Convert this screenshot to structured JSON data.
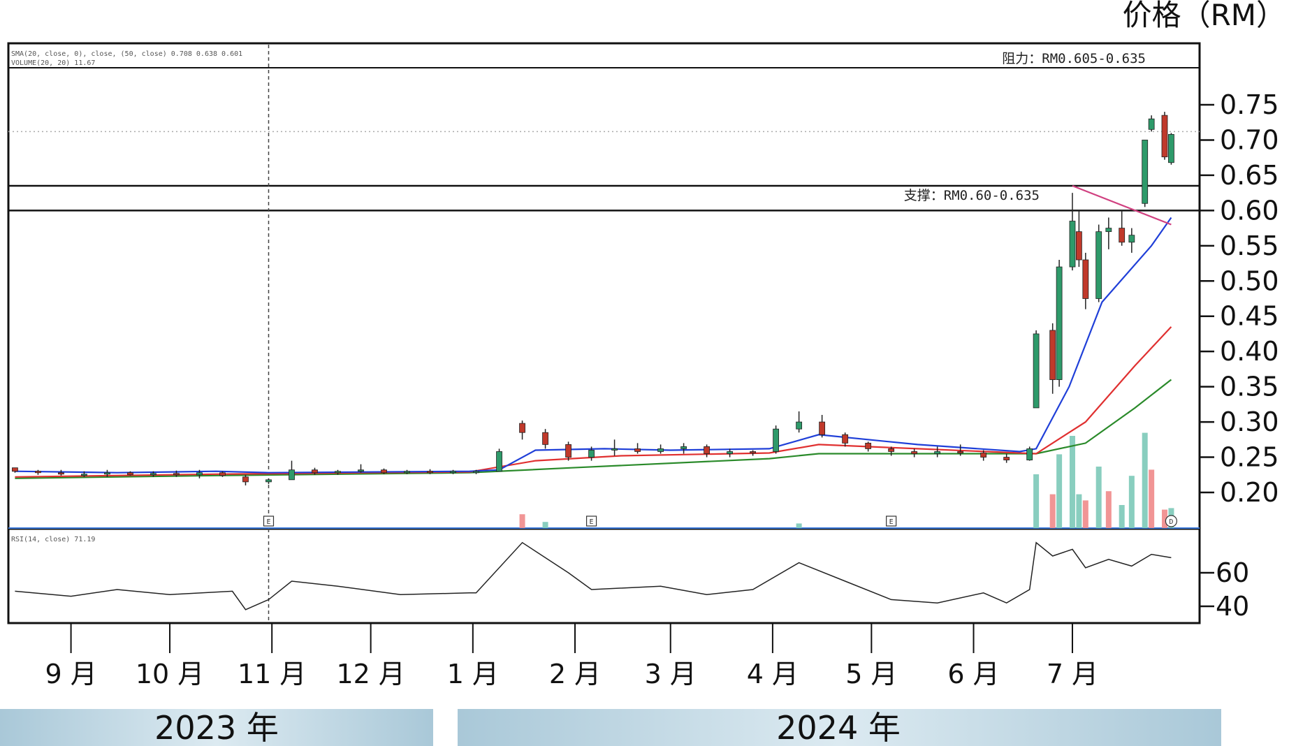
{
  "unit_label": "价格（RM）",
  "resistance_label": "阻力：RM0.605-0.635",
  "support_label": "支撑：RM0.60-0.635",
  "year_bars": [
    {
      "label": "2023 年"
    },
    {
      "label": "2024 年"
    }
  ],
  "indicator_legend": {
    "ma_line": "SMA(20, close, 0), close, (50, close) 0.708 0.638 0.601",
    "vol_line": "VOLUME(20, 20) 11.67",
    "rsi_line": "RSI(14, close) 71.19"
  },
  "event_markers": [
    "E",
    "E",
    "E",
    "D"
  ],
  "colors": {
    "up": "#2e9a6a",
    "down": "#c0392b",
    "ma_short": "#1f3fd8",
    "ma_mid": "#e03030",
    "ma_long": "#2a8a2a",
    "trendline": "#d04080",
    "volume_up": "#7cc9b8",
    "volume_down": "#f08a8a",
    "year_bar": "#c5dce6"
  },
  "chart_data": {
    "type": "candlestick",
    "ylabel": "价格（RM）",
    "price_ylim": [
      0.175,
      0.775
    ],
    "price_ticks": [
      "0.75",
      "0.70",
      "0.65",
      "0.60",
      "0.55",
      "0.50",
      "0.45",
      "0.40",
      "0.35",
      "0.30",
      "0.25",
      "0.20"
    ],
    "rsi_ticks": [
      "60",
      "40"
    ],
    "rsi_ylim": [
      30,
      80
    ],
    "months": [
      "9 月",
      "10 月",
      "11 月",
      "12 月",
      "1 月",
      "2 月",
      "3 月",
      "4 月",
      "5 月",
      "6 月",
      "7 月"
    ],
    "horizontal_levels": {
      "resistance_high": 0.712,
      "support_high": 0.635,
      "support_low": 0.6
    },
    "candles": [
      [
        "2023-08-15",
        0.235,
        0.235,
        0.228,
        0.23
      ],
      [
        "2023-08-22",
        0.23,
        0.232,
        0.225,
        0.228
      ],
      [
        "2023-08-29",
        0.228,
        0.232,
        0.224,
        0.226
      ],
      [
        "2023-09-05",
        0.226,
        0.23,
        0.222,
        0.226
      ],
      [
        "2023-09-12",
        0.226,
        0.232,
        0.222,
        0.228
      ],
      [
        "2023-09-19",
        0.228,
        0.23,
        0.224,
        0.225
      ],
      [
        "2023-09-26",
        0.225,
        0.23,
        0.222,
        0.227
      ],
      [
        "2023-10-03",
        0.227,
        0.231,
        0.222,
        0.225
      ],
      [
        "2023-10-10",
        0.225,
        0.232,
        0.22,
        0.228
      ],
      [
        "2023-10-17",
        0.228,
        0.23,
        0.222,
        0.224
      ],
      [
        "2023-10-24",
        0.222,
        0.225,
        0.21,
        0.215
      ],
      [
        "2023-10-31",
        0.215,
        0.22,
        0.212,
        0.218
      ],
      [
        "2023-11-07",
        0.218,
        0.245,
        0.218,
        0.232
      ],
      [
        "2023-11-14",
        0.232,
        0.235,
        0.225,
        0.228
      ],
      [
        "2023-11-21",
        0.228,
        0.232,
        0.225,
        0.23
      ],
      [
        "2023-11-28",
        0.23,
        0.24,
        0.228,
        0.232
      ],
      [
        "2023-12-05",
        0.232,
        0.234,
        0.226,
        0.228
      ],
      [
        "2023-12-12",
        0.228,
        0.232,
        0.226,
        0.23
      ],
      [
        "2023-12-19",
        0.23,
        0.233,
        0.226,
        0.228
      ],
      [
        "2023-12-26",
        0.228,
        0.232,
        0.226,
        0.23
      ],
      [
        "2024-01-02",
        0.23,
        0.232,
        0.226,
        0.23
      ],
      [
        "2024-01-09",
        0.23,
        0.262,
        0.23,
        0.258
      ],
      [
        "2024-01-16",
        0.298,
        0.302,
        0.275,
        0.285
      ],
      [
        "2024-01-23",
        0.285,
        0.29,
        0.262,
        0.268
      ],
      [
        "2024-01-30",
        0.268,
        0.272,
        0.245,
        0.25
      ],
      [
        "2024-02-06",
        0.25,
        0.265,
        0.245,
        0.26
      ],
      [
        "2024-02-13",
        0.26,
        0.275,
        0.252,
        0.262
      ],
      [
        "2024-02-20",
        0.262,
        0.27,
        0.255,
        0.258
      ],
      [
        "2024-02-27",
        0.258,
        0.268,
        0.255,
        0.262
      ],
      [
        "2024-03-05",
        0.262,
        0.27,
        0.255,
        0.265
      ],
      [
        "2024-03-12",
        0.265,
        0.268,
        0.25,
        0.255
      ],
      [
        "2024-03-19",
        0.255,
        0.262,
        0.25,
        0.258
      ],
      [
        "2024-03-26",
        0.258,
        0.26,
        0.252,
        0.256
      ],
      [
        "2024-04-02",
        0.258,
        0.295,
        0.255,
        0.29
      ],
      [
        "2024-04-09",
        0.29,
        0.315,
        0.285,
        0.3
      ],
      [
        "2024-04-16",
        0.3,
        0.31,
        0.278,
        0.282
      ],
      [
        "2024-04-23",
        0.282,
        0.285,
        0.265,
        0.27
      ],
      [
        "2024-04-30",
        0.27,
        0.272,
        0.258,
        0.262
      ],
      [
        "2024-05-07",
        0.262,
        0.265,
        0.252,
        0.258
      ],
      [
        "2024-05-14",
        0.258,
        0.262,
        0.25,
        0.255
      ],
      [
        "2024-05-21",
        0.255,
        0.265,
        0.25,
        0.258
      ],
      [
        "2024-05-28",
        0.258,
        0.268,
        0.252,
        0.256
      ],
      [
        "2024-06-04",
        0.256,
        0.26,
        0.245,
        0.25
      ],
      [
        "2024-06-11",
        0.25,
        0.255,
        0.242,
        0.246
      ],
      [
        "2024-06-18",
        0.246,
        0.265,
        0.245,
        0.262
      ],
      [
        "2024-06-20",
        0.32,
        0.43,
        0.32,
        0.425
      ],
      [
        "2024-06-25",
        0.43,
        0.44,
        0.34,
        0.36
      ],
      [
        "2024-06-27",
        0.36,
        0.53,
        0.35,
        0.52
      ],
      [
        "2024-07-01",
        0.52,
        0.625,
        0.515,
        0.585
      ],
      [
        "2024-07-03",
        0.57,
        0.6,
        0.52,
        0.53
      ],
      [
        "2024-07-05",
        0.53,
        0.54,
        0.46,
        0.475
      ],
      [
        "2024-07-09",
        0.475,
        0.58,
        0.47,
        0.57
      ],
      [
        "2024-07-12",
        0.57,
        0.59,
        0.545,
        0.575
      ],
      [
        "2024-07-16",
        0.575,
        0.6,
        0.55,
        0.555
      ],
      [
        "2024-07-19",
        0.555,
        0.575,
        0.54,
        0.565
      ],
      [
        "2024-07-23",
        0.61,
        0.7,
        0.605,
        0.7
      ],
      [
        "2024-07-25",
        0.715,
        0.735,
        0.712,
        0.73
      ],
      [
        "2024-07-29",
        0.735,
        0.74,
        0.672,
        0.676
      ],
      [
        "2024-07-31",
        0.668,
        0.71,
        0.665,
        0.708
      ]
    ],
    "ma_short": [
      [
        "2023-08-15",
        0.23
      ],
      [
        "2023-09-15",
        0.228
      ],
      [
        "2023-10-15",
        0.23
      ],
      [
        "2023-10-31",
        0.228
      ],
      [
        "2023-11-30",
        0.229
      ],
      [
        "2023-12-31",
        0.23
      ],
      [
        "2024-01-09",
        0.232
      ],
      [
        "2024-01-20",
        0.26
      ],
      [
        "2024-02-10",
        0.262
      ],
      [
        "2024-03-01",
        0.26
      ],
      [
        "2024-03-31",
        0.262
      ],
      [
        "2024-04-15",
        0.282
      ],
      [
        "2024-05-15",
        0.268
      ],
      [
        "2024-06-15",
        0.258
      ],
      [
        "2024-06-20",
        0.262
      ],
      [
        "2024-06-30",
        0.35
      ],
      [
        "2024-07-10",
        0.47
      ],
      [
        "2024-07-25",
        0.55
      ],
      [
        "2024-07-31",
        0.59
      ]
    ],
    "ma_mid": [
      [
        "2023-08-15",
        0.222
      ],
      [
        "2023-10-15",
        0.226
      ],
      [
        "2023-11-30",
        0.228
      ],
      [
        "2023-12-31",
        0.229
      ],
      [
        "2024-01-20",
        0.245
      ],
      [
        "2024-02-15",
        0.252
      ],
      [
        "2024-03-31",
        0.256
      ],
      [
        "2024-04-15",
        0.268
      ],
      [
        "2024-05-15",
        0.262
      ],
      [
        "2024-06-20",
        0.255
      ],
      [
        "2024-07-05",
        0.3
      ],
      [
        "2024-07-20",
        0.38
      ],
      [
        "2024-07-31",
        0.435
      ]
    ],
    "ma_long": [
      [
        "2023-08-15",
        0.22
      ],
      [
        "2023-10-15",
        0.224
      ],
      [
        "2023-12-31",
        0.228
      ],
      [
        "2024-01-31",
        0.235
      ],
      [
        "2024-03-31",
        0.248
      ],
      [
        "2024-04-15",
        0.255
      ],
      [
        "2024-06-20",
        0.255
      ],
      [
        "2024-07-05",
        0.27
      ],
      [
        "2024-07-20",
        0.32
      ],
      [
        "2024-07-31",
        0.36
      ]
    ],
    "trendline": [
      [
        "2024-07-01",
        0.635
      ],
      [
        "2024-07-31",
        0.58
      ]
    ],
    "rsi": [
      [
        "2023-08-15",
        49
      ],
      [
        "2023-09-01",
        46
      ],
      [
        "2023-09-15",
        50
      ],
      [
        "2023-10-01",
        47
      ],
      [
        "2023-10-20",
        49
      ],
      [
        "2023-10-24",
        38
      ],
      [
        "2023-10-31",
        44
      ],
      [
        "2023-11-07",
        55
      ],
      [
        "2023-11-21",
        52
      ],
      [
        "2023-12-10",
        47
      ],
      [
        "2023-12-31",
        48
      ],
      [
        "2024-01-02",
        48
      ],
      [
        "2024-01-16",
        78
      ],
      [
        "2024-01-30",
        60
      ],
      [
        "2024-02-06",
        50
      ],
      [
        "2024-02-27",
        52
      ],
      [
        "2024-03-12",
        47
      ],
      [
        "2024-03-26",
        50
      ],
      [
        "2024-04-09",
        66
      ],
      [
        "2024-04-23",
        55
      ],
      [
        "2024-05-07",
        44
      ],
      [
        "2024-05-21",
        42
      ],
      [
        "2024-06-04",
        48
      ],
      [
        "2024-06-11",
        42
      ],
      [
        "2024-06-18",
        50
      ],
      [
        "2024-06-20",
        78
      ],
      [
        "2024-06-25",
        70
      ],
      [
        "2024-07-01",
        74
      ],
      [
        "2024-07-05",
        63
      ],
      [
        "2024-07-12",
        68
      ],
      [
        "2024-07-19",
        64
      ],
      [
        "2024-07-25",
        71
      ],
      [
        "2024-07-31",
        69
      ]
    ],
    "volume": [
      [
        "2024-01-16",
        0.9,
        "down"
      ],
      [
        "2024-01-23",
        0.4,
        "up"
      ],
      [
        "2024-04-09",
        0.3,
        "up"
      ],
      [
        "2024-06-20",
        3.5,
        "up"
      ],
      [
        "2024-06-25",
        2.2,
        "down"
      ],
      [
        "2024-06-27",
        4.8,
        "up"
      ],
      [
        "2024-07-01",
        6.0,
        "up"
      ],
      [
        "2024-07-03",
        2.2,
        "up"
      ],
      [
        "2024-07-05",
        1.8,
        "down"
      ],
      [
        "2024-07-09",
        4.0,
        "up"
      ],
      [
        "2024-07-12",
        2.4,
        "down"
      ],
      [
        "2024-07-16",
        1.5,
        "up"
      ],
      [
        "2024-07-19",
        3.4,
        "up"
      ],
      [
        "2024-07-23",
        6.2,
        "up"
      ],
      [
        "2024-07-25",
        3.8,
        "down"
      ],
      [
        "2024-07-29",
        1.2,
        "down"
      ],
      [
        "2024-07-31",
        1.3,
        "up"
      ]
    ]
  }
}
